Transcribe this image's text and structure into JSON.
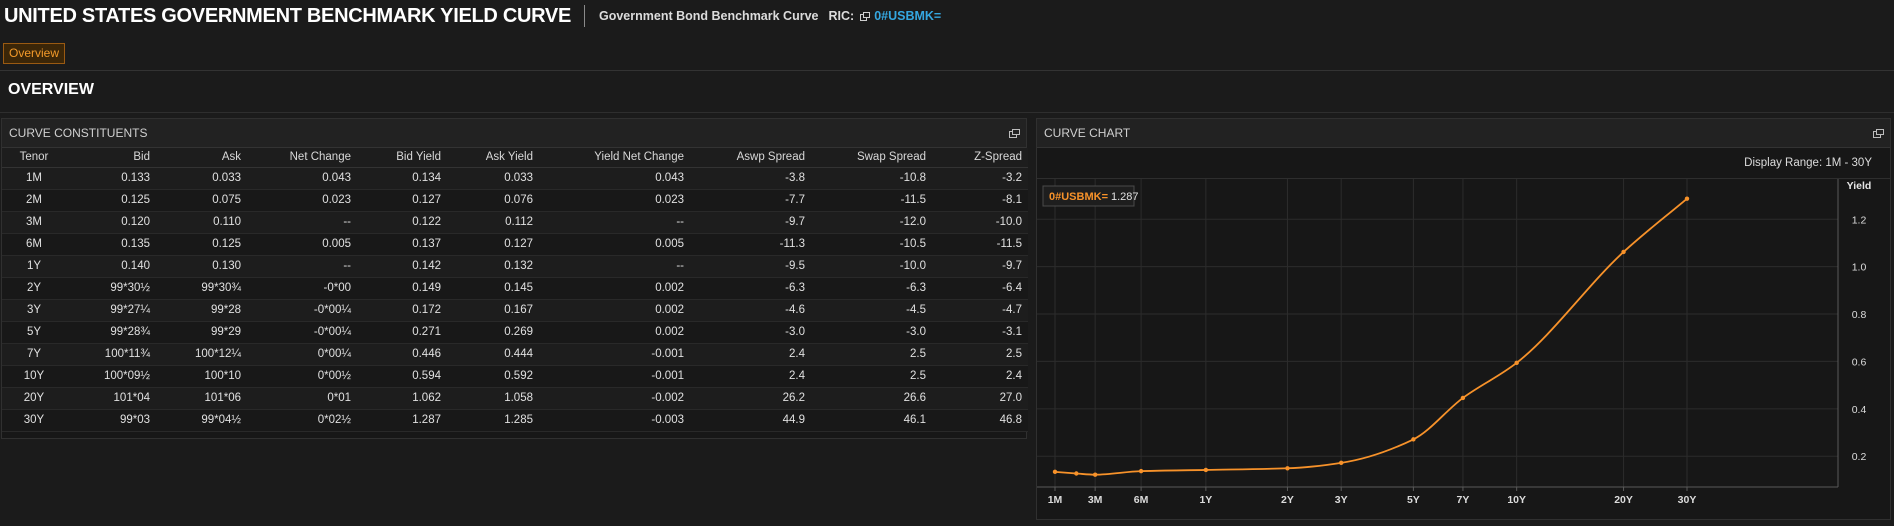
{
  "header": {
    "title": "UNITED STATES GOVERNMENT BENCHMARK YIELD CURVE",
    "subtitle": "Government Bond Benchmark Curve",
    "ric_label": "RIC:",
    "ric_value": "0#USBMK="
  },
  "tabs": [
    {
      "label": "Overview",
      "active": true
    }
  ],
  "section_title": "OVERVIEW",
  "constituents": {
    "title": "CURVE CONSTITUENTS",
    "columns": [
      "Tenor",
      "Bid",
      "Ask",
      "Net Change",
      "Bid Yield",
      "Ask Yield",
      "Yield Net Change",
      "Aswp Spread",
      "Swap Spread",
      "Z-Spread"
    ],
    "rows": [
      [
        "1M",
        "0.133",
        "0.033",
        "0.043",
        "0.134",
        "0.033",
        "0.043",
        "-3.8",
        "-10.8",
        "-3.2"
      ],
      [
        "2M",
        "0.125",
        "0.075",
        "0.023",
        "0.127",
        "0.076",
        "0.023",
        "-7.7",
        "-11.5",
        "-8.1"
      ],
      [
        "3M",
        "0.120",
        "0.110",
        "--",
        "0.122",
        "0.112",
        "--",
        "-9.7",
        "-12.0",
        "-10.0"
      ],
      [
        "6M",
        "0.135",
        "0.125",
        "0.005",
        "0.137",
        "0.127",
        "0.005",
        "-11.3",
        "-10.5",
        "-11.5"
      ],
      [
        "1Y",
        "0.140",
        "0.130",
        "--",
        "0.142",
        "0.132",
        "--",
        "-9.5",
        "-10.0",
        "-9.7"
      ],
      [
        "2Y",
        "99*30½",
        "99*30¾",
        "-0*00",
        "0.149",
        "0.145",
        "0.002",
        "-6.3",
        "-6.3",
        "-6.4"
      ],
      [
        "3Y",
        "99*27¼",
        "99*28",
        "-0*00¼",
        "0.172",
        "0.167",
        "0.002",
        "-4.6",
        "-4.5",
        "-4.7"
      ],
      [
        "5Y",
        "99*28¾",
        "99*29",
        "-0*00¼",
        "0.271",
        "0.269",
        "0.002",
        "-3.0",
        "-3.0",
        "-3.1"
      ],
      [
        "7Y",
        "100*11¾",
        "100*12¼",
        "0*00¼",
        "0.446",
        "0.444",
        "-0.001",
        "2.4",
        "2.5",
        "2.5"
      ],
      [
        "10Y",
        "100*09½",
        "100*10",
        "0*00½",
        "0.594",
        "0.592",
        "-0.001",
        "2.4",
        "2.5",
        "2.4"
      ],
      [
        "20Y",
        "101*04",
        "101*06",
        "0*01",
        "1.062",
        "1.058",
        "-0.002",
        "26.2",
        "26.6",
        "27.0"
      ],
      [
        "30Y",
        "99*03",
        "99*04½",
        "0*02½",
        "1.287",
        "1.285",
        "-0.003",
        "44.9",
        "46.1",
        "46.8"
      ]
    ]
  },
  "chart": {
    "title": "CURVE CHART",
    "display_range_label": "Display Range: 1M - 30Y",
    "legend_name": "0#USBMK=",
    "legend_value": "1.287",
    "y_axis_title": "Yield",
    "line_color": "#f7922a",
    "accent_color": "#35a7e0"
  },
  "chart_data": {
    "type": "line",
    "xlabel": "",
    "ylabel": "Yield",
    "x_tick_labels": [
      "1M",
      "3M",
      "6M",
      "1Y",
      "2Y",
      "3Y",
      "5Y",
      "7Y",
      "10Y",
      "20Y",
      "30Y"
    ],
    "x_ticks_years": [
      0.0833,
      0.25,
      0.5,
      1,
      2,
      3,
      5,
      7,
      10,
      20,
      30
    ],
    "y_ticks": [
      0.2,
      0.4,
      0.6,
      0.8,
      1.0,
      1.2
    ],
    "ylim": [
      0.07,
      1.37
    ],
    "grid": true,
    "series": [
      {
        "name": "0#USBMK=",
        "points": [
          {
            "x": 0.0833,
            "y": 0.134
          },
          {
            "x": 0.1667,
            "y": 0.127
          },
          {
            "x": 0.25,
            "y": 0.122
          },
          {
            "x": 0.5,
            "y": 0.137
          },
          {
            "x": 1,
            "y": 0.142
          },
          {
            "x": 2,
            "y": 0.149
          },
          {
            "x": 3,
            "y": 0.172
          },
          {
            "x": 5,
            "y": 0.271
          },
          {
            "x": 7,
            "y": 0.446
          },
          {
            "x": 10,
            "y": 0.594
          },
          {
            "x": 20,
            "y": 1.062
          },
          {
            "x": 30,
            "y": 1.287
          }
        ]
      }
    ]
  }
}
